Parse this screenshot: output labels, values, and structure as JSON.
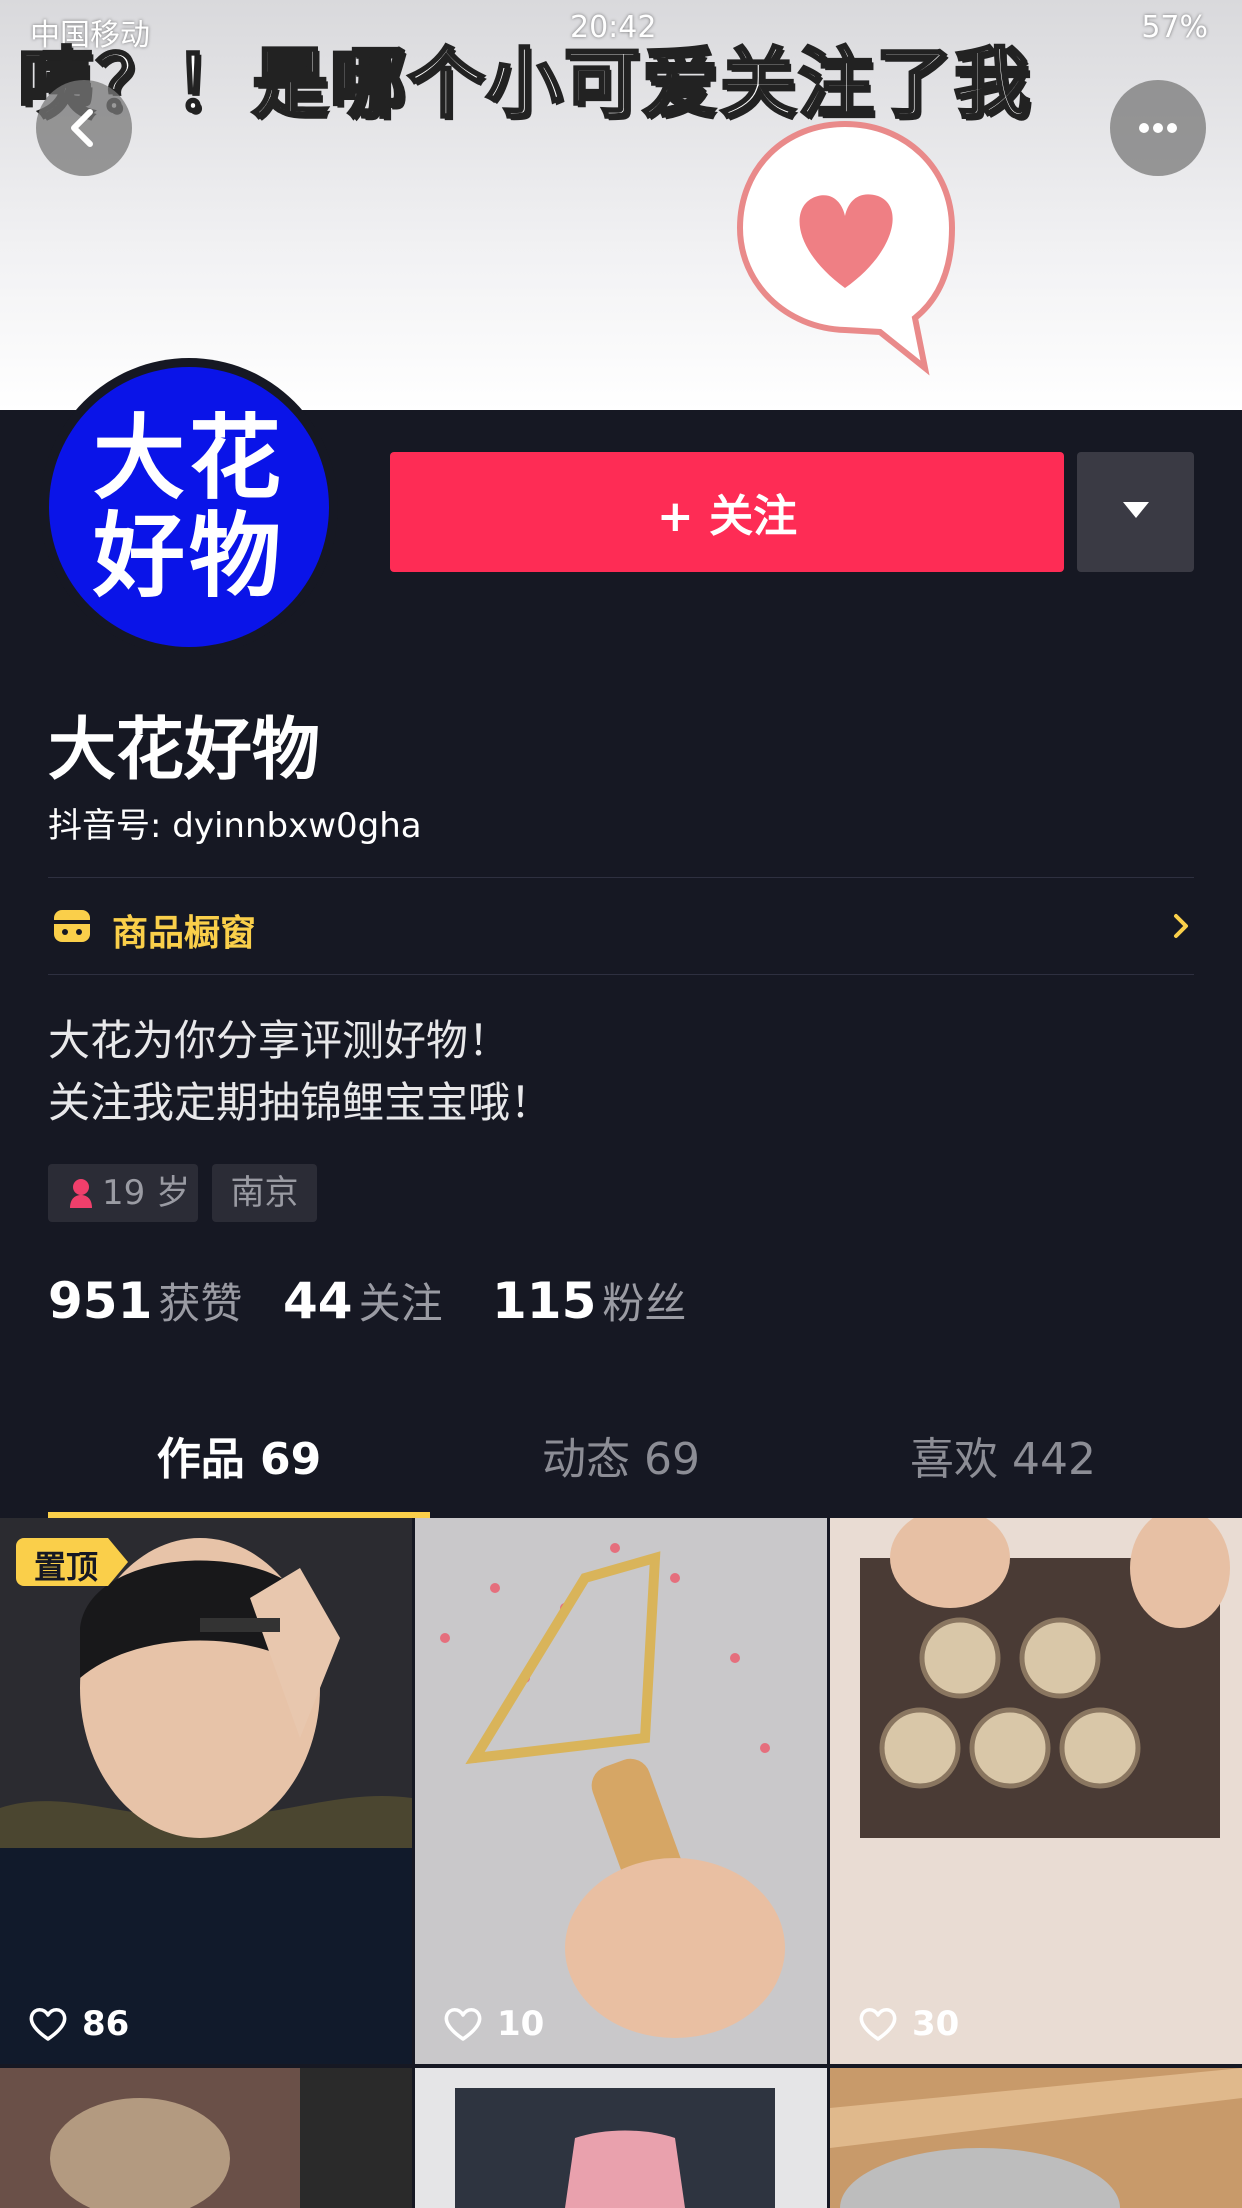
{
  "status_bar": {
    "carrier": "中国移动",
    "time": "20:42",
    "battery": "57%"
  },
  "banner": {
    "title": "咦？！是哪个小可爱关注了我"
  },
  "profile": {
    "avatar_text_1": "大花",
    "avatar_text_2": "好物",
    "name": "大花好物",
    "douyin_id": "抖音号: dyinnbxw0gha",
    "follow_label": "+ 关注"
  },
  "shop": {
    "label": "商品橱窗"
  },
  "bio": {
    "line1": "大花为你分享评测好物！",
    "line2": "关注我定期抽锦鲤宝宝哦！"
  },
  "tags": {
    "age": "19 岁",
    "city": "南京"
  },
  "stats": {
    "likes_count": "951",
    "likes_label": "获赞",
    "following_count": "44",
    "following_label": "关注",
    "fans_count": "115",
    "fans_label": "粉丝"
  },
  "tabs": [
    {
      "label": "作品 69"
    },
    {
      "label": "动态 69"
    },
    {
      "label": "喜欢 442"
    }
  ],
  "videos": [
    {
      "likes": "86",
      "badge": "置顶"
    },
    {
      "likes": "10"
    },
    {
      "likes": "30"
    }
  ],
  "colors": {
    "accent_red": "#fe2c55",
    "tab_indicator": "#facf4a",
    "background": "#161823"
  }
}
